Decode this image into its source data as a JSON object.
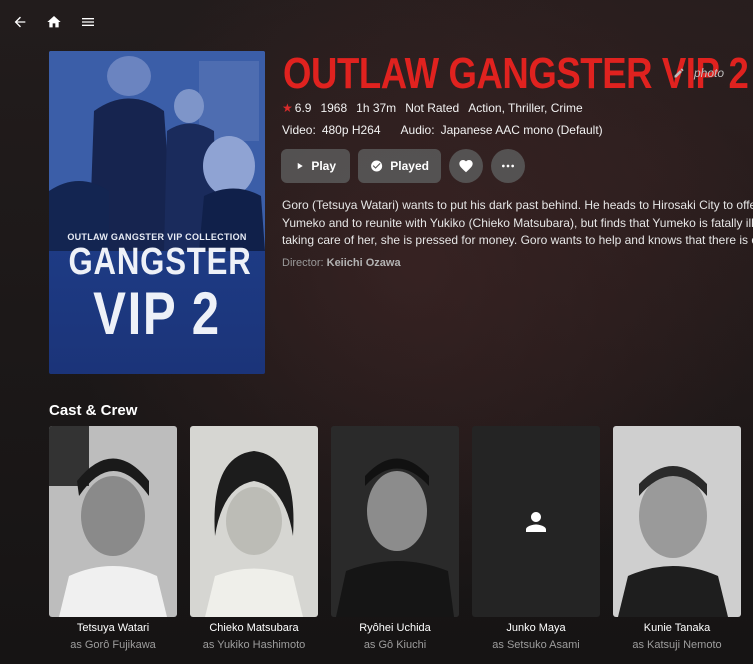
{
  "nav": {
    "back_icon": "arrow-left-icon",
    "home_icon": "home-icon",
    "menu_icon": "menu-icon"
  },
  "poster": {
    "collection": "OUTLAW GANGSTER VIP COLLECTION",
    "line1": "GANGSTER",
    "line2": "VIP 2"
  },
  "title": "OUTLAW GANGSTER VIP 2",
  "edit_label": "photo",
  "meta": {
    "rating": "6.9",
    "year": "1968",
    "runtime": "1h 37m",
    "certification": "Not Rated",
    "genres": "Action, Thriller, Crime"
  },
  "media": {
    "video_label": "Video:",
    "video_value": "480p H264",
    "audio_label": "Audio:",
    "audio_value": "Japanese AAC mono (Default)"
  },
  "actions": {
    "play_label": "Play",
    "played_label": "Played"
  },
  "overview": [
    "Goro (Tetsuya Watari) wants to put his dark past behind. He heads to Hirosaki City to offer his",
    "Yumeko and to reunite with Yukiko (Chieko Matsubara), but finds that Yumeko is fatally ill. Alth",
    "taking care of her, she is pressed for money. Goro wants to help and knows that there is only c"
  ],
  "director": {
    "label": "Director:",
    "name": "Keiichi Ozawa"
  },
  "cast_section_title": "Cast & Crew",
  "cast": [
    {
      "name": "Tetsuya Watari",
      "role": "as Gorô Fujikawa"
    },
    {
      "name": "Chieko Matsubara",
      "role": "as Yukiko Hashimoto"
    },
    {
      "name": "Ryôhei Uchida",
      "role": "as Gô Kiuchi"
    },
    {
      "name": "Junko Maya",
      "role": "as Setsuko Asami"
    },
    {
      "name": "Kunie Tanaka",
      "role": "as Katsuji Nemoto"
    }
  ],
  "colors": {
    "title": "#e0221f",
    "star": "#d92b2b",
    "button_bg": "#5a5a5a"
  }
}
